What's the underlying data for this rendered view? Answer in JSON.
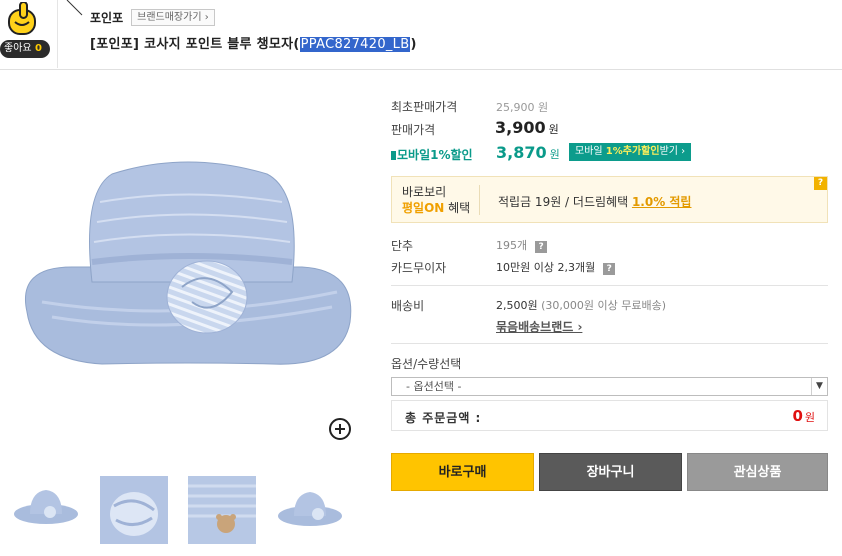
{
  "like": {
    "label": "좋아요",
    "count": "0"
  },
  "brand": {
    "name": "포인포",
    "store_button": "브랜드매장가기 ›"
  },
  "product": {
    "title_prefix": "[포인포] 코사지 포인트 블루 챙모자(",
    "title_code": "PPAC827420_LB",
    "title_suffix": ")"
  },
  "price": {
    "original_label": "최초판매가격",
    "original_value": "25,900 원",
    "sale_label": "판매가격",
    "sale_value": "3,900",
    "won": "원",
    "mobile_label": "모바일1%할인",
    "mobile_value": "3,870",
    "mobile_button_prefix": "모바일 ",
    "mobile_button_em": "1%추가할인",
    "mobile_button_suffix": "받기 ›"
  },
  "benefit": {
    "line1": "바로보리",
    "line2_on": "평일ON",
    "line2_rest": " 혜택",
    "desc_prefix": "적립금 19원 / 더드림혜택 ",
    "desc_pct": "1.0% 적립",
    "help": "?"
  },
  "unit": {
    "label": "단추",
    "value": "195개"
  },
  "card": {
    "label": "카드무이자",
    "value": "10만원 이상 2,3개월"
  },
  "shipping": {
    "label": "배송비",
    "value": "2,500원",
    "sub": " (30,000원 이상 무료배송)",
    "link": "묶음배송브랜드 ›"
  },
  "options": {
    "label": "옵션/수량선택",
    "select_value": "- 옵션선택 -",
    "total_label": "총 주문금액 :",
    "total_value": "0",
    "total_won": "원"
  },
  "buttons": {
    "buy": "바로구매",
    "cart": "장바구니",
    "wish": "관심상품"
  },
  "colors": {
    "accent_teal": "#0c9c8c",
    "buy_yellow": "#ffc400",
    "total_red": "#e01010"
  }
}
